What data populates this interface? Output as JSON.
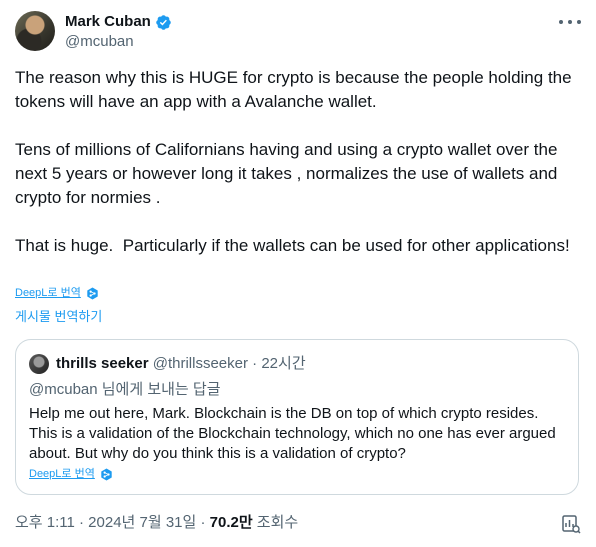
{
  "author": {
    "name": "Mark Cuban",
    "handle": "@mcuban"
  },
  "tweet": {
    "text": "The reason why this is HUGE for crypto is because the people holding the tokens will have an app with a Avalanche wallet.\n\nTens of millions of Californians having and using a crypto wallet over the next 5 years or however long it takes , normalizes the use of wallets and crypto for normies .\n\nThat is huge.  Particularly if the wallets can be used for other applications!",
    "deepl_label": "DeepL로 번역",
    "translate_label": "게시물 번역하기"
  },
  "quote": {
    "name": "thrills seeker",
    "handle": "@thrillsseeker",
    "separator": "·",
    "time": "22시간",
    "reply_mention": "@mcuban",
    "reply_suffix": " 님에게 보내는 답글",
    "text": "Help me out here, Mark. Blockchain is the DB on top of which crypto resides. This is a validation of the Blockchain technology, which no one has ever argued about. But why do you think this is a validation of crypto?",
    "deepl_label": "DeepL로 번역"
  },
  "footer": {
    "datetime": "오후 1:11 · 2024년 7월 31일 · ",
    "views_count": "70.2만",
    "views_label": " 조회수"
  },
  "colors": {
    "accent": "#1d9bf0",
    "text": "#0f1419",
    "muted": "#536471",
    "border": "#cfd9de"
  },
  "icons": [
    "verified-badge-icon",
    "more-icon",
    "deepl-icon",
    "view-stats-icon"
  ]
}
